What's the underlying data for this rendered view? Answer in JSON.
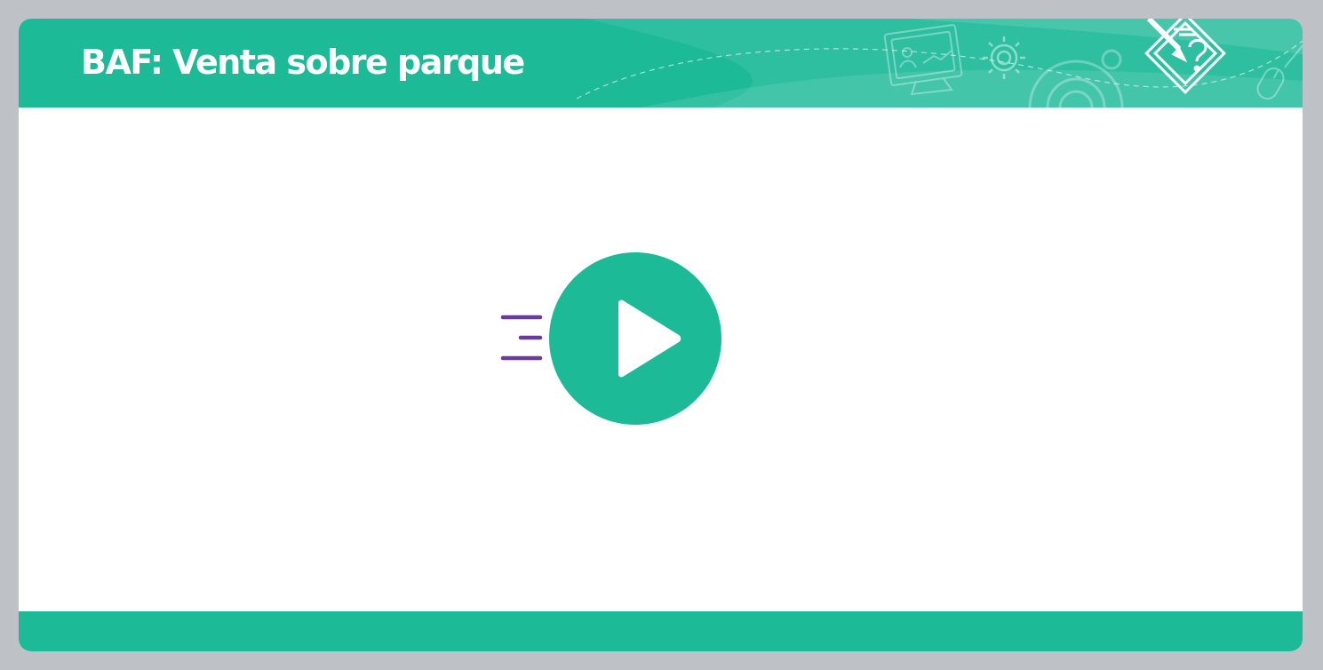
{
  "header": {
    "title": "BAF: Venta sobre parque"
  },
  "player": {
    "play_icon": "play-icon",
    "speed_icon": "motion-lines-icon"
  },
  "decor_icons": [
    "presentation-monitor-icon",
    "gear-icon",
    "large-gear-icon",
    "pencil-question-icon",
    "mouse-icon"
  ],
  "colors": {
    "page_background": "#bec2c6",
    "accent_green": "#1dba98",
    "motion_lines_purple": "#6a3aa1",
    "card_background": "#ffffff"
  }
}
